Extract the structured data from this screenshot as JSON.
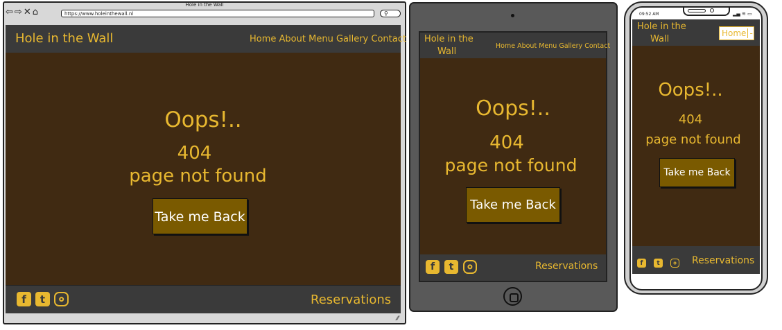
{
  "desktop": {
    "window_title": "Hole in the Wall",
    "url": "https://www.holeinthewall.nl",
    "brand": "Hole in the Wall",
    "nav": [
      "Home",
      "About",
      "Menu",
      "Gallery",
      "Contact"
    ],
    "error": {
      "heading": "Oops!..",
      "code": "404",
      "message": "page not found"
    },
    "back_button": "Take me Back",
    "footer": {
      "reservations": "Reservations",
      "social": [
        "facebook-icon",
        "twitter-icon",
        "instagram-icon"
      ]
    }
  },
  "tablet": {
    "brand_line1": "Hole in the",
    "brand_line2": "Wall",
    "nav": [
      "Home",
      "About",
      "Menu",
      "Gallery",
      "Contact"
    ],
    "error": {
      "heading": "Oops!..",
      "code": "404",
      "message": "page not found"
    },
    "back_button": "Take me Back",
    "footer": {
      "reservations": "Reservations"
    }
  },
  "phone": {
    "status_time": "09:52 AM",
    "brand_line1": "Hole in the",
    "brand_line2": "Wall",
    "nav_select": "Home",
    "nav_select_chevron": "-",
    "error": {
      "heading": "Oops!..",
      "code": "404",
      "message": "page not found"
    },
    "back_button": "Take me Back",
    "footer": {
      "reservations": "Reservations"
    }
  },
  "colors": {
    "header_bg": "#3a3a3a",
    "page_bg": "#402a12",
    "accent": "#e8b830",
    "button_bg": "#7a5a00"
  }
}
